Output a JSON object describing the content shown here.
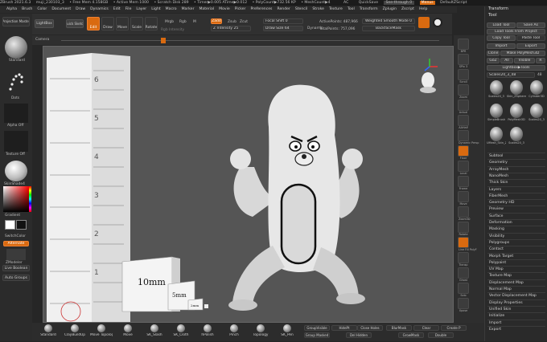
{
  "title_bar": {
    "app": "ZBrush 2021.6.3",
    "doc": "muji_230103_3",
    "free_mem": "• Free Mem 4.158GB",
    "active_mem": "• Active Mem 1000",
    "scratch": "• Scratch Disk 289",
    "timer": "• Timer▶0.005 ATime▶0.012",
    "polycount": "• PolyCount▶732.56 KP",
    "meshcount": "• MeshCount▶4",
    "ac": "AC",
    "quicksave": "QuickSave",
    "see_through": "See-through 0",
    "menus_label": "Menus",
    "default_script": "DefaultZScript"
  },
  "menu_bar": [
    "Alpha",
    "Brush",
    "Color",
    "Document",
    "Draw",
    "Dynamics",
    "Edit",
    "File",
    "Layer",
    "Light",
    "Macro",
    "Marker",
    "Material",
    "Movie",
    "Picker",
    "Preferences",
    "Render",
    "Stencil",
    "Stroke",
    "Texture",
    "Tool",
    "Transform",
    "Zplugin",
    "Zscript",
    "Help"
  ],
  "left_shelf": {
    "projection_master": "Projection Master",
    "standard": "Standard",
    "dots": "Dots",
    "alpha_off": "Alpha Off",
    "texture_off": "Texture Off",
    "material": "SkinShade4",
    "gradient": "Gradient",
    "switch_color": "SwitchColor",
    "alternate": "Alternate",
    "zmodeler": "ZModeler",
    "live_boolean": "Live Boolean",
    "auto_groups": "Auto Groups"
  },
  "top_shelf": {
    "lightbox": "LightBox",
    "quick_sketch": "Quick Sketch",
    "edit": "Edit",
    "draw": "Draw",
    "move": "Move",
    "scale": "Scale",
    "rotate": "Rotate",
    "rgb_intensity": "Rgb Intensity",
    "mrgb": "Mrgb",
    "rgb": "Rgb",
    "m": "M",
    "zadd": "Zadd",
    "zsub": "Zsub",
    "zcut": "Zcut",
    "z_intensity": "Z Intensity 25",
    "focal_shift": "Focal Shift 0",
    "draw_size": "Draw Size 64",
    "dynamic": "Dynamic",
    "active_points": "ActivePoints: 487,966",
    "total_points": "TotalPoints: 757,096",
    "weighted_smooth": "Weighted Smooth Mode 0",
    "backface_mask": "BackfaceMask"
  },
  "doc_bar": {
    "camera": "Camera"
  },
  "viewport": {
    "card_big": "10mm",
    "card_mid": "5mm",
    "card_small": "2mm",
    "ruler_marks": [
      "6",
      "5",
      "4",
      "3",
      "2",
      "1"
    ]
  },
  "right_shelf": [
    "BPR",
    "SPix 3",
    "Scroll",
    "Zoom",
    "Actual",
    "AAHalf",
    "Dynamic Persp",
    "Floor",
    "Local",
    "Frame",
    "Move",
    "Zoom3D",
    "Rotate",
    "Line Fill PolyF",
    "Transp",
    "Ghost",
    "Solo",
    "Xpose"
  ],
  "tool_palette": {
    "header1": "Transform",
    "header2": "Tool",
    "load_tool": "Load Tool",
    "save_as": "Save As",
    "load_from_project": "Load Tools From Project",
    "copy_tool": "Copy Tool",
    "paste_tool": "Paste Tool",
    "import": "Import",
    "export": "Export",
    "clone": "Clone",
    "make_polymesh": "Make PolyMesh3D",
    "goz": "GoZ",
    "all": "All",
    "visible": "Visible",
    "r": "R",
    "lightbox_tools": "Lightbox▶Tools",
    "current_tool": "Scales20_3_48",
    "count": "48",
    "thumbs": [
      "Scales20_3",
      "Skin_ZSphere1",
      "Cylinder3D",
      "SimpleBrush",
      "PolyMesh3D",
      "Scales20_3",
      "UMesh_Skin_ZSp",
      "Scales20_3"
    ],
    "sections": [
      "Subtool",
      "Geometry",
      "ArrayMesh",
      "NanoMesh",
      "Thick Skin",
      "Layers",
      "FiberMesh",
      "Geometry HD",
      "Preview",
      "Surface",
      "Deformation",
      "Masking",
      "Visibility",
      "Polygroups",
      "Contact",
      "Morph Target",
      "Polypaint",
      "UV Map",
      "Texture Map",
      "Displacement Map",
      "Normal Map",
      "Vector Displacement Map",
      "Display Properties",
      "Unified Skin",
      "Initialize",
      "Import",
      "Export"
    ]
  },
  "bottom_shelf": {
    "brushes": [
      "Standard",
      "ClayBuildUp",
      "Move Topologic",
      "Move",
      "SK_Slash",
      "SK_Cloth",
      "hPolish",
      "Pinch",
      "Topology",
      "SK_Pen"
    ],
    "group_visible": "GroupVisible",
    "hide_pt": "HidePt",
    "close_holes": "Close Holes",
    "blur_mask": "BlurMask",
    "clear": "Clear",
    "create": "Create P",
    "group_masked": "Group Masked",
    "del_hidden": "Del Hidden",
    "grow_mask": "GrowMask",
    "double": "Double"
  },
  "colors": {
    "accent": "#d96a10",
    "viewport_bg": "#555555"
  }
}
